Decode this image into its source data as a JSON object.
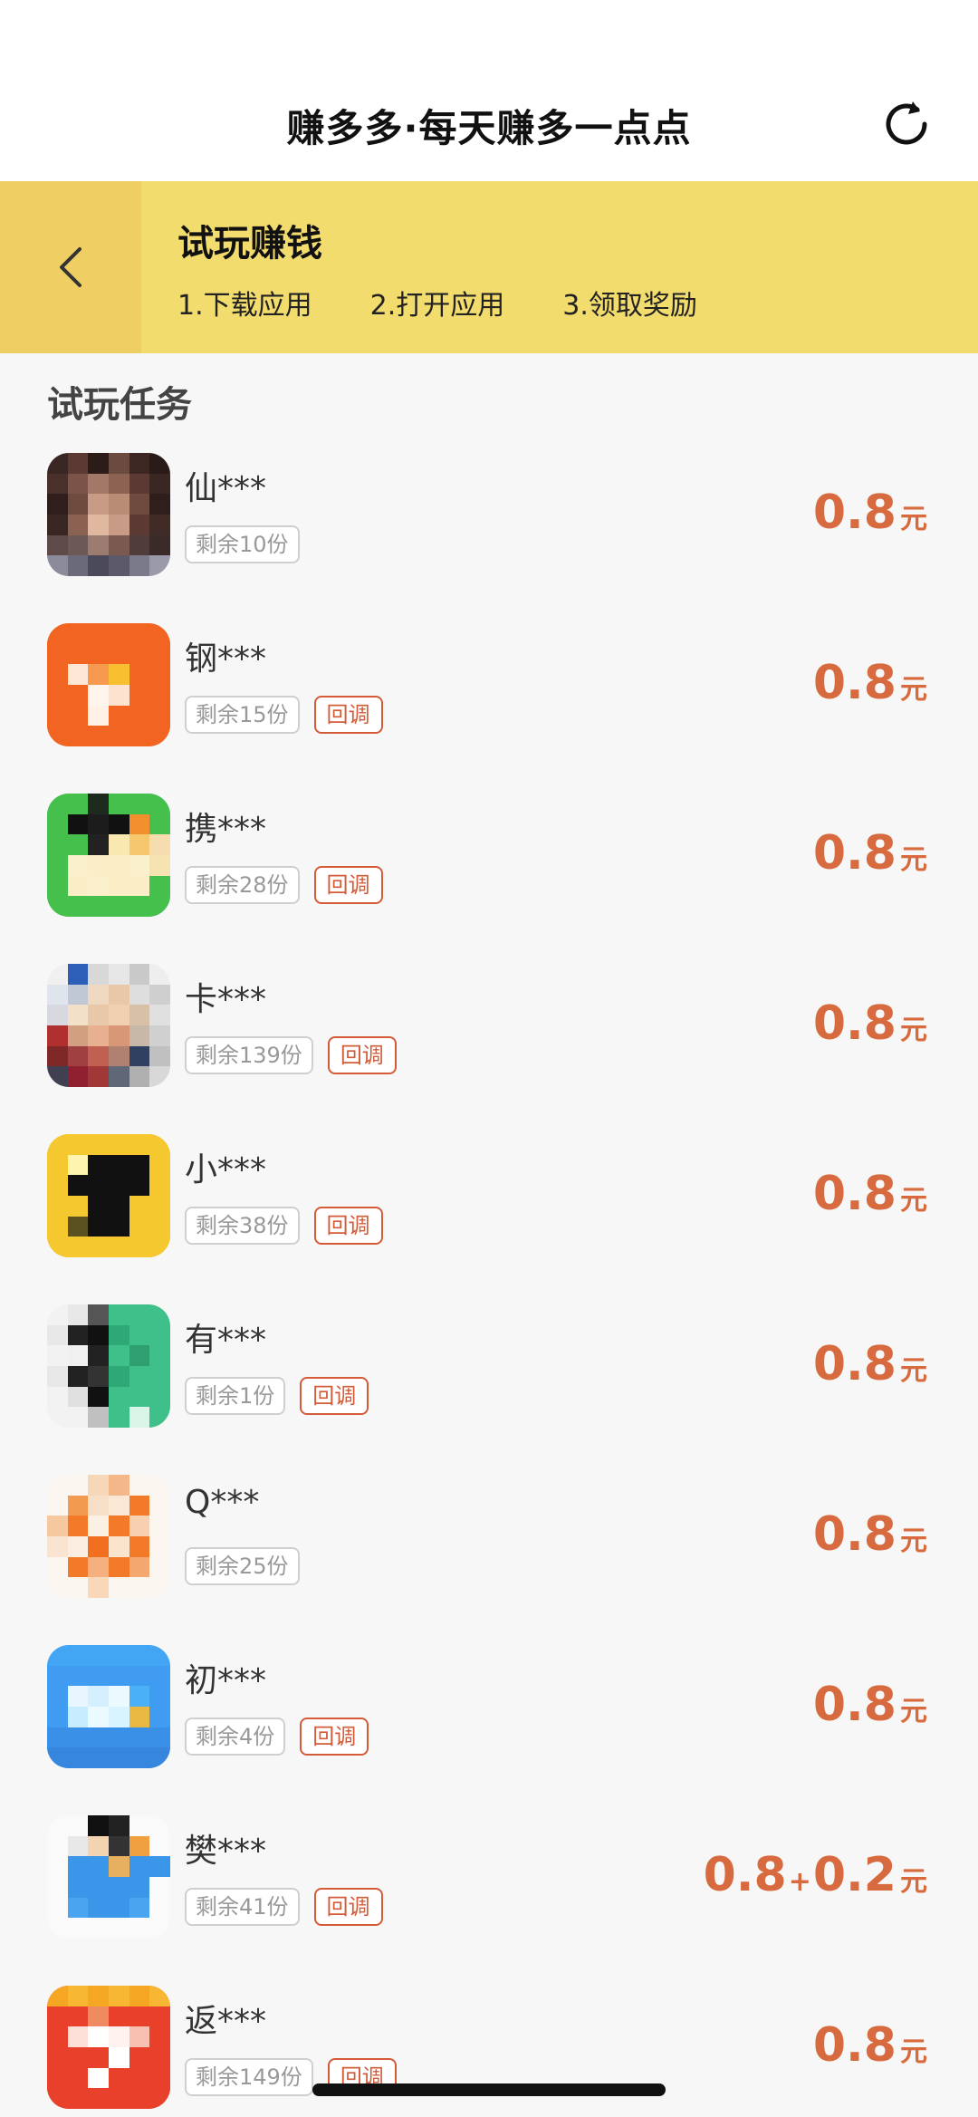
{
  "header": {
    "title": "赚多多·每天赚多一点点",
    "refresh_icon": "refresh-icon"
  },
  "banner": {
    "back_icon": "chevron-left-icon",
    "title": "试玩赚钱",
    "steps": [
      "1.下载应用",
      "2.打开应用",
      "3.领取奖励"
    ]
  },
  "section": {
    "title": "试玩任务"
  },
  "tasks": [
    {
      "name": "仙***",
      "remaining": "剩余10份",
      "callback": "",
      "reward": "0.8",
      "bonus": "",
      "unit": "元"
    },
    {
      "name": "钢***",
      "remaining": "剩余15份",
      "callback": "回调",
      "reward": "0.8",
      "bonus": "",
      "unit": "元"
    },
    {
      "name": "携***",
      "remaining": "剩余28份",
      "callback": "回调",
      "reward": "0.8",
      "bonus": "",
      "unit": "元"
    },
    {
      "name": "卡***",
      "remaining": "剩余139份",
      "callback": "回调",
      "reward": "0.8",
      "bonus": "",
      "unit": "元"
    },
    {
      "name": "小***",
      "remaining": "剩余38份",
      "callback": "回调",
      "reward": "0.8",
      "bonus": "",
      "unit": "元"
    },
    {
      "name": "有***",
      "remaining": "剩余1份",
      "callback": "回调",
      "reward": "0.8",
      "bonus": "",
      "unit": "元"
    },
    {
      "name": "Q***",
      "remaining": "剩余25份",
      "callback": "",
      "reward": "0.8",
      "bonus": "",
      "unit": "元"
    },
    {
      "name": "初***",
      "remaining": "剩余4份",
      "callback": "回调",
      "reward": "0.8",
      "bonus": "",
      "unit": "元"
    },
    {
      "name": "樊***",
      "remaining": "剩余41份",
      "callback": "回调",
      "reward": "0.8",
      "bonus": "0.2",
      "unit": "元"
    },
    {
      "name": "返***",
      "remaining": "剩余149份",
      "callback": "回调",
      "reward": "0.8",
      "bonus": "",
      "unit": "元"
    }
  ],
  "colors": {
    "accent": "#d86a3f",
    "banner": "#f3dc6e",
    "banner_back": "#efcf64"
  }
}
